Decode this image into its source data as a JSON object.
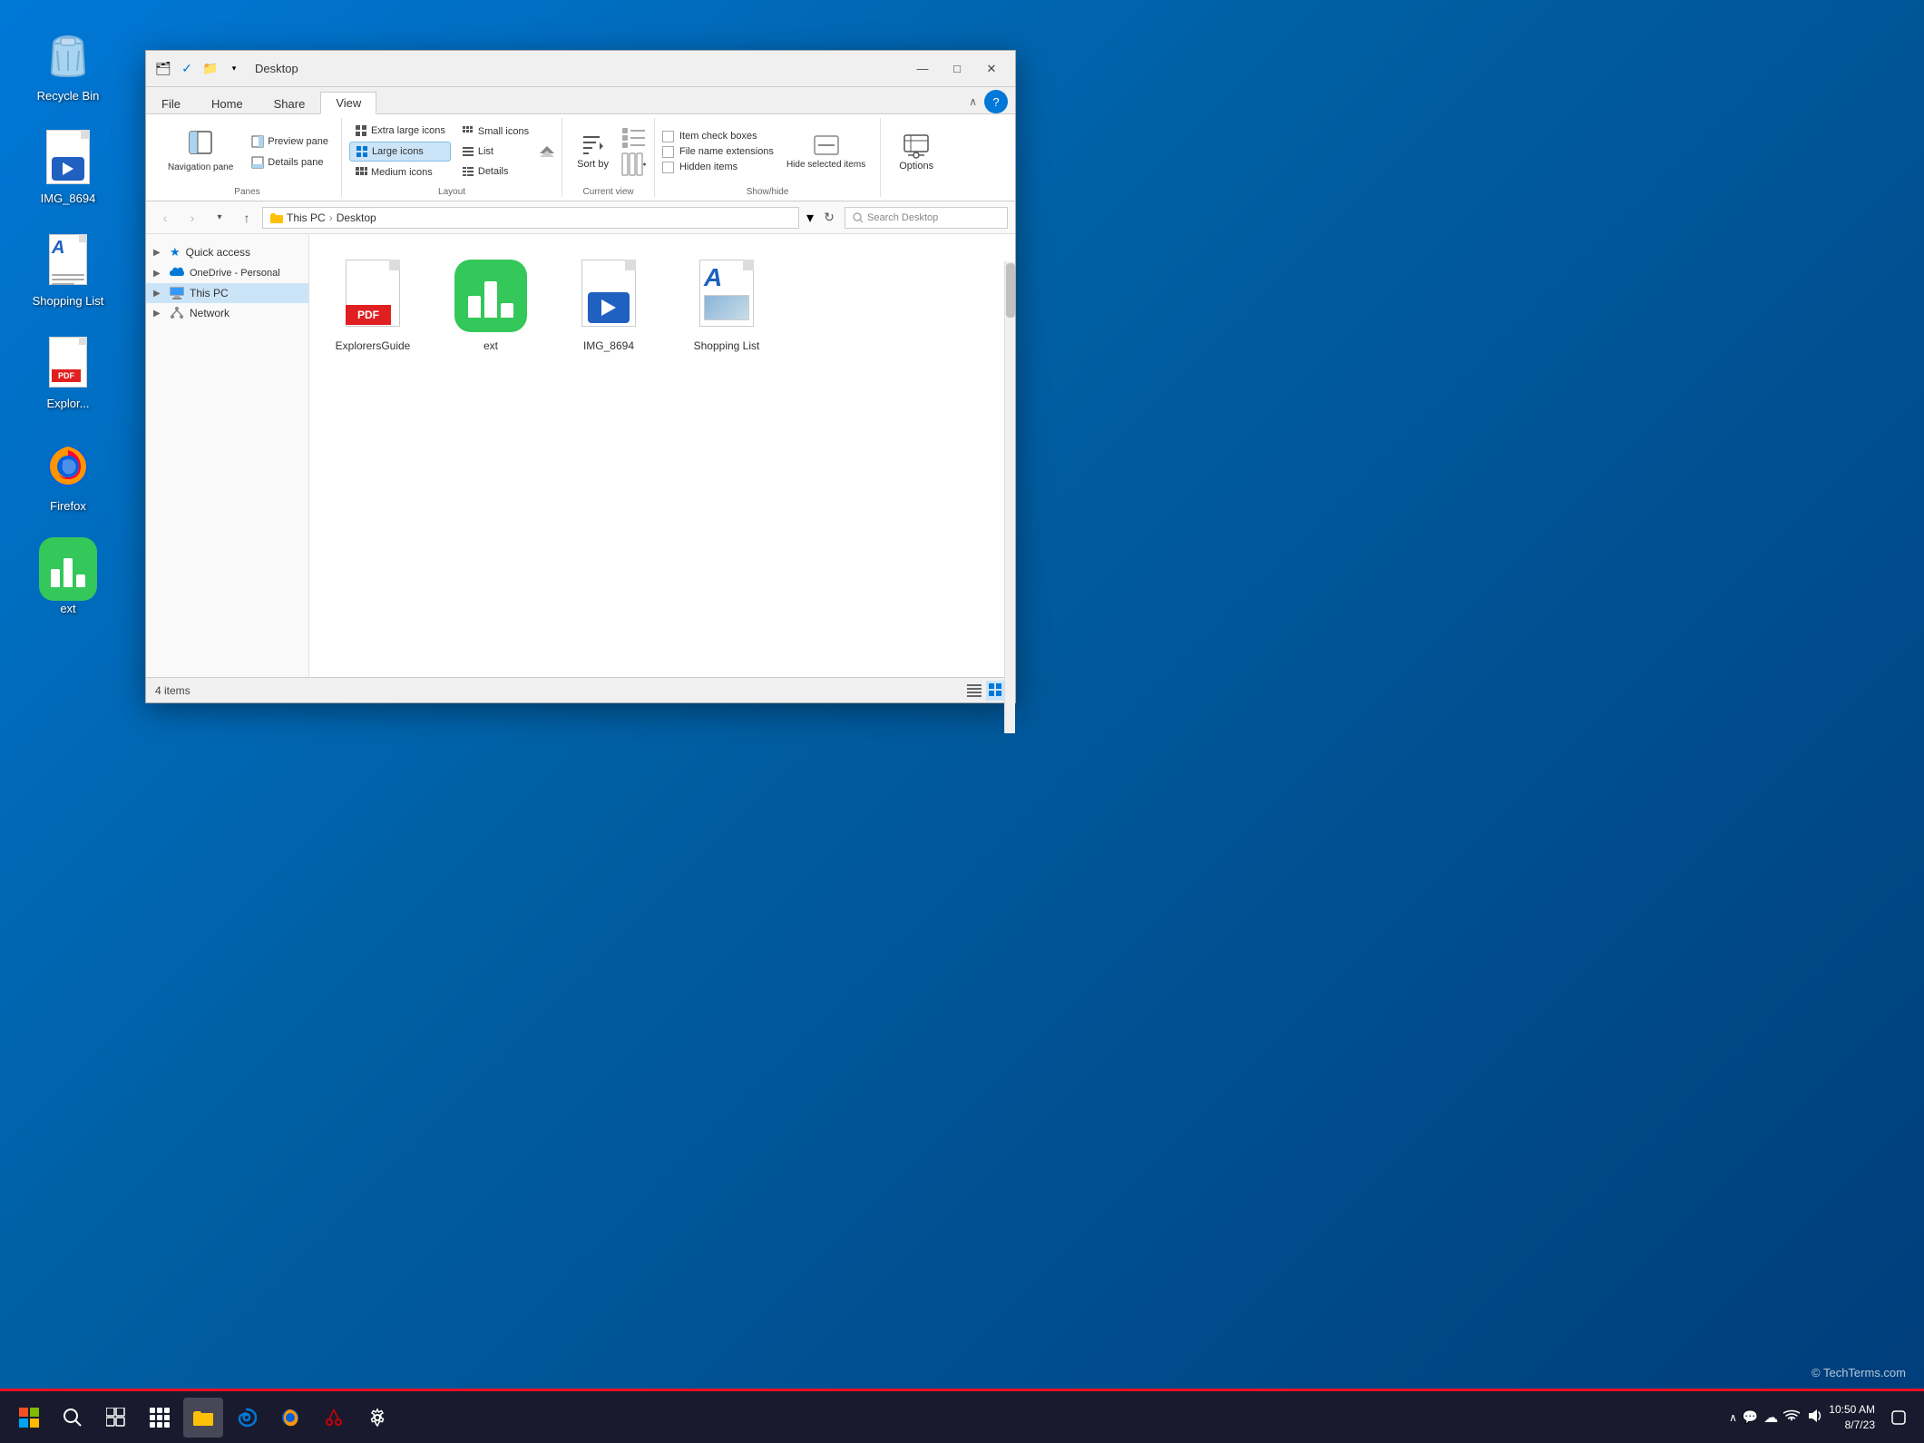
{
  "window": {
    "title": "Desktop",
    "minimize_label": "—",
    "maximize_label": "□",
    "close_label": "✕"
  },
  "titlebar": {
    "quick_icons": [
      "🔵",
      "✓",
      "📁",
      "▾"
    ]
  },
  "tabs": {
    "file_label": "File",
    "home_label": "Home",
    "share_label": "Share",
    "view_label": "View"
  },
  "ribbon": {
    "panes_label": "Panes",
    "layout_label": "Layout",
    "current_view_label": "Current view",
    "show_hide_label": "Show/hide",
    "navigation_pane_label": "Navigation pane",
    "preview_pane_label": "Preview pane",
    "details_pane_label": "Details pane",
    "extra_large_label": "Extra large icons",
    "large_label": "Large icons",
    "medium_label": "Medium icons",
    "small_label": "Small icons",
    "list_label": "List",
    "details_label": "Details",
    "sort_by_label": "Sort by",
    "item_checkboxes_label": "Item check boxes",
    "file_name_ext_label": "File name extensions",
    "hidden_items_label": "Hidden items",
    "hide_selected_label": "Hide selected items",
    "options_label": "Options"
  },
  "address": {
    "this_pc": "This PC",
    "desktop": "Desktop",
    "search_placeholder": "Search Desktop"
  },
  "sidebar": {
    "quick_access_label": "Quick access",
    "onedrive_label": "OneDrive - Personal",
    "this_pc_label": "This PC",
    "network_label": "Network"
  },
  "files": [
    {
      "name": "ExplorersGuide",
      "type": "pdf"
    },
    {
      "name": "ext",
      "type": "chart"
    },
    {
      "name": "IMG_8694",
      "type": "video"
    },
    {
      "name": "Shopping List",
      "type": "doc"
    }
  ],
  "status": {
    "item_count": "4 items"
  },
  "desktop_icons": [
    {
      "name": "Recycle Bin",
      "icon": "recycle",
      "id": "recycle-bin"
    },
    {
      "name": "IMG_8694",
      "icon": "video",
      "id": "img-8694"
    },
    {
      "name": "Shopping List",
      "icon": "doc",
      "id": "shopping-list"
    },
    {
      "name": "Explor...",
      "icon": "pdf",
      "id": "explorers"
    },
    {
      "name": "Firefox",
      "icon": "firefox",
      "id": "firefox"
    },
    {
      "name": "ext",
      "icon": "chart",
      "id": "ext-app"
    }
  ],
  "taskbar": {
    "time": "10:50 AM",
    "date": "8/7/23"
  },
  "watermark": "© TechTerms.com",
  "chart_bars": [
    {
      "height": 20,
      "color": "white"
    },
    {
      "height": 32,
      "color": "white"
    },
    {
      "height": 14,
      "color": "white"
    }
  ]
}
